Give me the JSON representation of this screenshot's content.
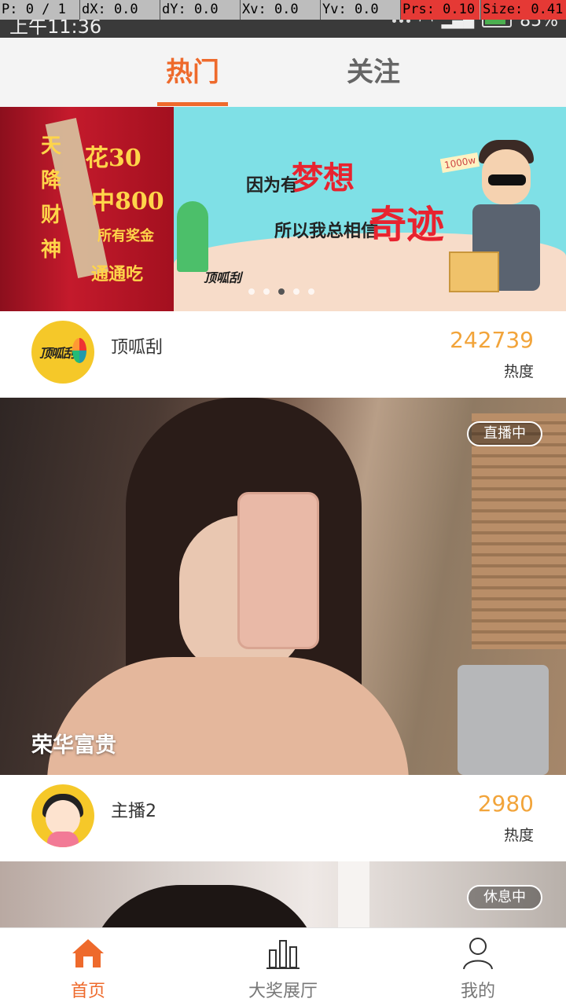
{
  "status_bar": {
    "time": "上午11:36",
    "battery": "85%"
  },
  "debug_overlay": {
    "p": "P: 0 / 1",
    "dx": "dX: 0.0",
    "dy": "dY: 0.0",
    "xv": "Xv: 0.0",
    "yv": "Yv: 0.0",
    "prs": "Prs: 0.10",
    "size": "Size: 0.41"
  },
  "tabs": {
    "hot": "热门",
    "follow": "关注",
    "active": "hot"
  },
  "banner": {
    "left": {
      "vertical_text": "天降财神",
      "line1": "花30",
      "line2": "中800",
      "line3": "所有奖金",
      "line4": "通通吃"
    },
    "right": {
      "text1": "因为有",
      "text2": "梦想",
      "text3": "所以我总相信",
      "text4": "奇迹",
      "badge": "1000w",
      "logo": "顶呱刮"
    },
    "dots_count": 5,
    "active_dot": 2
  },
  "hosts": [
    {
      "name": "顶呱刮",
      "heat": "242739",
      "heat_label": "热度",
      "avatar_icon": "dingguagua-logo-icon",
      "cover_title": "荣华富贵",
      "status": "直播中"
    },
    {
      "name": "主播2",
      "heat": "2980",
      "heat_label": "热度",
      "avatar_icon": "girl-avatar-icon",
      "status": "休息中"
    }
  ],
  "bottom_nav": {
    "home": "首页",
    "hall": "大奖展厅",
    "me": "我的",
    "active": "home"
  },
  "colors": {
    "accent": "#ee6a2c",
    "heat": "#f2a43a",
    "avatar_bg": "#f5c829"
  }
}
